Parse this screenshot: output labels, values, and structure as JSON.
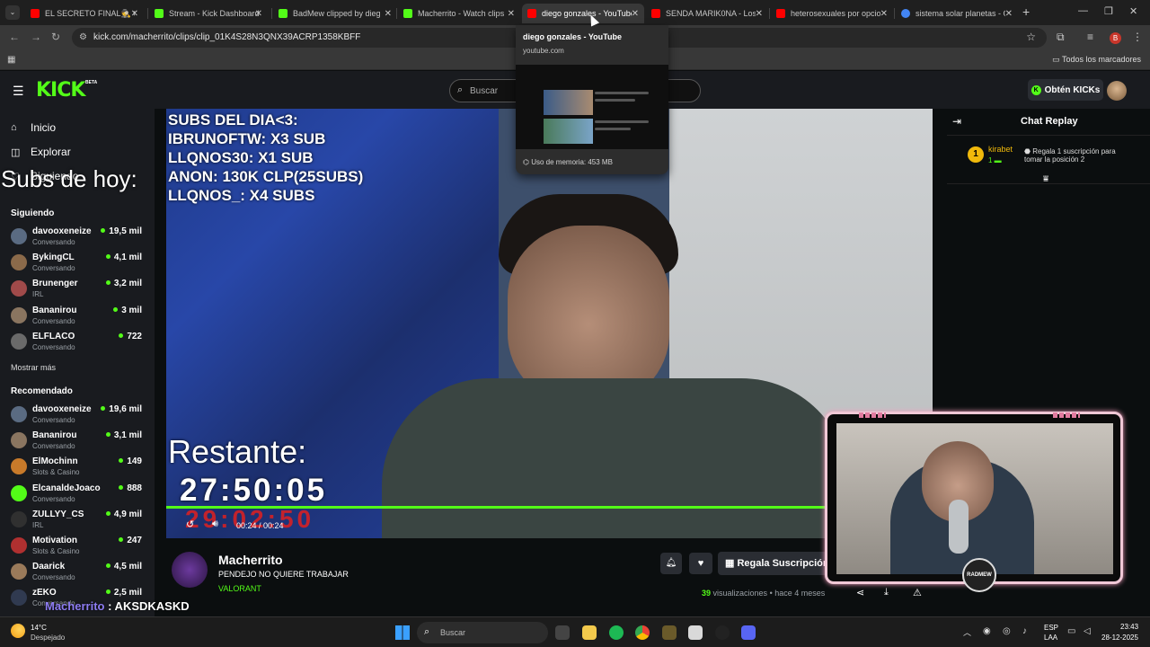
{
  "browser": {
    "tabs": [
      {
        "title": "EL SECRETO FINAL🕵️ Caj",
        "color": "#ff0000"
      },
      {
        "title": "Stream - Kick Dashboard",
        "color": "#53fc18"
      },
      {
        "title": "BadMew clipped by dieg",
        "color": "#53fc18"
      },
      {
        "title": "Macherrito - Watch clips",
        "color": "#53fc18"
      },
      {
        "title": "diego gonzales - YouTube",
        "color": "#ff0000"
      },
      {
        "title": "SENDA MARIK0NA - Los",
        "color": "#ff0000"
      },
      {
        "title": "heterosexuales por opcio",
        "color": "#ff0000"
      },
      {
        "title": "sistema solar planetas - G",
        "color": "#4285f4"
      }
    ],
    "active_tab": 4,
    "url": "kick.com/macherrito/clips/clip_01K4S28N3QNX39ACRP1358KBFF",
    "bookmarks_all": "Todos los marcadores",
    "hover_card": {
      "title": "diego gonzales - YouTube",
      "domain": "youtube.com",
      "memory": "Uso de memoria: 453 MB"
    }
  },
  "kick": {
    "logo": "KICK",
    "beta": "BETA",
    "search_placeholder": "Buscar",
    "get_kicks": "Obtén KICKs",
    "nav": [
      {
        "label": "Inicio",
        "icon": "home-icon"
      },
      {
        "label": "Explorar",
        "icon": "compass-icon"
      },
      {
        "label": "Siguiendo",
        "icon": "heart-icon"
      }
    ],
    "following_header": "Siguiendo",
    "following": [
      {
        "name": "davooxeneize",
        "category": "Conversando",
        "viewers": "19,5 mil",
        "color": "#5a6b82"
      },
      {
        "name": "BykingCL",
        "category": "Conversando",
        "viewers": "4,1 mil",
        "color": "#8b6a4a"
      },
      {
        "name": "Brunenger",
        "category": "IRL",
        "viewers": "3,2 mil",
        "color": "#a04a4a"
      },
      {
        "name": "Bananirou",
        "category": "Conversando",
        "viewers": "3 mil",
        "color": "#8a7560"
      },
      {
        "name": "ELFLACO",
        "category": "Conversando",
        "viewers": "722",
        "color": "#6a6a6a"
      }
    ],
    "show_more": "Mostrar más",
    "recommended_header": "Recomendado",
    "recommended": [
      {
        "name": "davooxeneize",
        "category": "Conversando",
        "viewers": "19,6 mil",
        "color": "#5a6b82"
      },
      {
        "name": "Bananirou",
        "category": "Conversando",
        "viewers": "3,1 mil",
        "color": "#8a7560"
      },
      {
        "name": "ElMochinn",
        "category": "Slots & Casino",
        "viewers": "149",
        "color": "#c87a2a"
      },
      {
        "name": "ElcanaldeJoaco",
        "category": "Conversando",
        "viewers": "888",
        "color": "#53fc18"
      },
      {
        "name": "ZULLYY_CS",
        "category": "IRL",
        "viewers": "4,9 mil",
        "color": "#303030"
      },
      {
        "name": "Motivation",
        "category": "Slots & Casino",
        "viewers": "247",
        "color": "#b03030"
      },
      {
        "name": "Daarick",
        "category": "Conversando",
        "viewers": "4,5 mil",
        "color": "#9a7a5a"
      },
      {
        "name": "zEKO",
        "category": "Conversando",
        "viewers": "2,5 mil",
        "color": "#303a50"
      }
    ]
  },
  "video": {
    "subs_lines": [
      "SUBS DEL DIA<3:",
      "IBRUNOFTW: X3 SUB",
      "LLQNOS30: X1 SUB",
      "ANON: 130K CLP(25SUBS)",
      "LLQNOS_: X4 SUBS"
    ],
    "subs_today": "Subs de hoy:",
    "remaining_label": "Restante:",
    "countdown": "27:50:05",
    "countdown_ghost": "29:02:50",
    "time": "00:24 / 00:24",
    "progress_fraction": 1.0,
    "cam_logo": "RADMEW"
  },
  "chat": {
    "title": "Chat Replay",
    "gifter": {
      "rank": "1",
      "user": "kirabet",
      "count": "1",
      "desc": "Regala 1 suscripción para tomar la posición 2"
    },
    "overlay_user": "Macherrito",
    "overlay_msg": ": AKSDKASKD"
  },
  "channel": {
    "name": "Macherrito",
    "title": "PENDEJO NO QUIERE TRABAJAR",
    "game": "VALORANT",
    "gift_label": "Regala Suscripción",
    "views_count": "39",
    "views_text": "visualizaciones",
    "age": "• hace 4 meses"
  },
  "taskbar": {
    "weather_temp": "14°C",
    "weather_desc": "Despejado",
    "search_placeholder": "Buscar",
    "lang1": "ESP",
    "lang2": "LAA",
    "time": "23:43",
    "date": "28-12-2025"
  }
}
